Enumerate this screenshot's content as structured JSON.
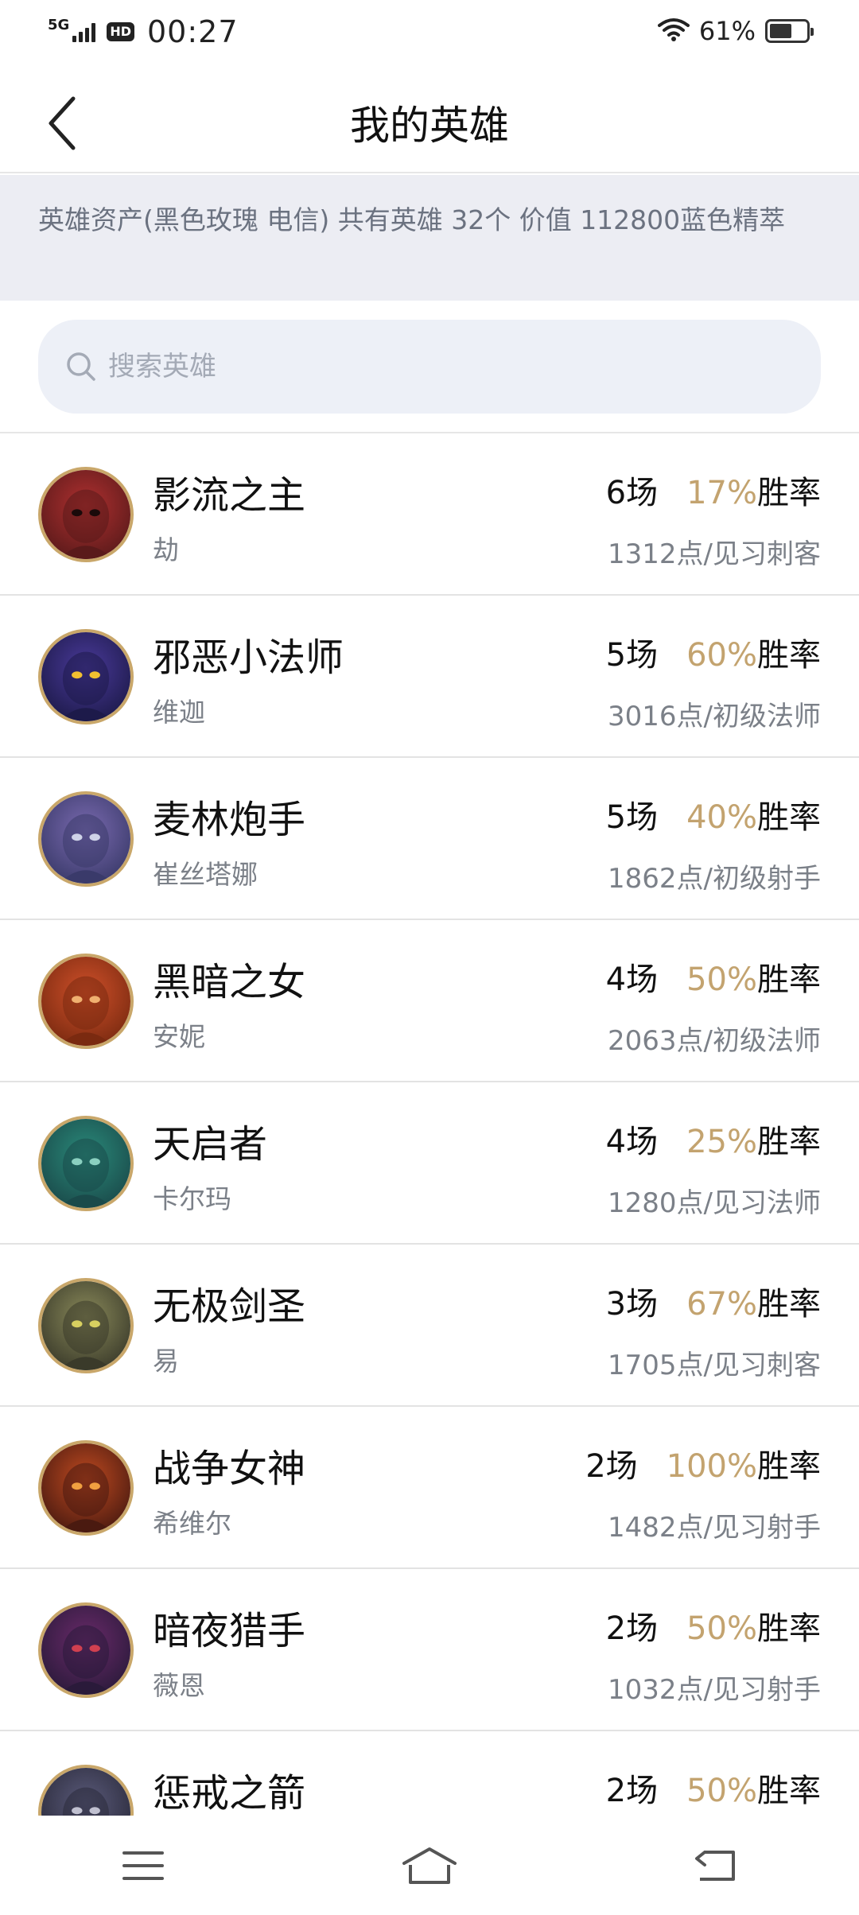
{
  "status_bar": {
    "network": "5G",
    "hd": "HD",
    "time": "00:27",
    "battery_percent": "61%",
    "battery_level": 0.61
  },
  "header": {
    "back_icon": "chevron-left-icon",
    "title": "我的英雄"
  },
  "info": {
    "text": "英雄资产(黑色玫瑰 电信)  共有英雄 32个  价值 112800蓝色精萃"
  },
  "search": {
    "icon": "search-icon",
    "placeholder": "搜索英雄",
    "value": ""
  },
  "colors": {
    "accent_gold": "#c3a36f",
    "secondary_text": "#7b8088",
    "banner_bg": "#ecedf3",
    "search_bg": "#edf0f7"
  },
  "heroes": [
    {
      "name": "影流之主",
      "champion": "劫",
      "games": "6场",
      "rate": "17%",
      "rate_suffix": "胜率",
      "detail": "1312点/见习刺客"
    },
    {
      "name": "邪恶小法师",
      "champion": "维迦",
      "games": "5场",
      "rate": "60%",
      "rate_suffix": "胜率",
      "detail": "3016点/初级法师"
    },
    {
      "name": "麦林炮手",
      "champion": "崔丝塔娜",
      "games": "5场",
      "rate": "40%",
      "rate_suffix": "胜率",
      "detail": "1862点/初级射手"
    },
    {
      "name": "黑暗之女",
      "champion": "安妮",
      "games": "4场",
      "rate": "50%",
      "rate_suffix": "胜率",
      "detail": "2063点/初级法师"
    },
    {
      "name": "天启者",
      "champion": "卡尔玛",
      "games": "4场",
      "rate": "25%",
      "rate_suffix": "胜率",
      "detail": "1280点/见习法师"
    },
    {
      "name": "无极剑圣",
      "champion": "易",
      "games": "3场",
      "rate": "67%",
      "rate_suffix": "胜率",
      "detail": "1705点/见习刺客"
    },
    {
      "name": "战争女神",
      "champion": "希维尔",
      "games": "2场",
      "rate": "100%",
      "rate_suffix": "胜率",
      "detail": "1482点/见习射手"
    },
    {
      "name": "暗夜猎手",
      "champion": "薇恩",
      "games": "2场",
      "rate": "50%",
      "rate_suffix": "胜率",
      "detail": "1032点/见习射手"
    },
    {
      "name": "惩戒之箭",
      "champion": "",
      "games": "2场",
      "rate": "50%",
      "rate_suffix": "胜率",
      "detail": ""
    }
  ],
  "nav": {
    "menu_icon": "menu-icon",
    "home_icon": "home-icon",
    "back_icon": "back-arrow-icon"
  }
}
